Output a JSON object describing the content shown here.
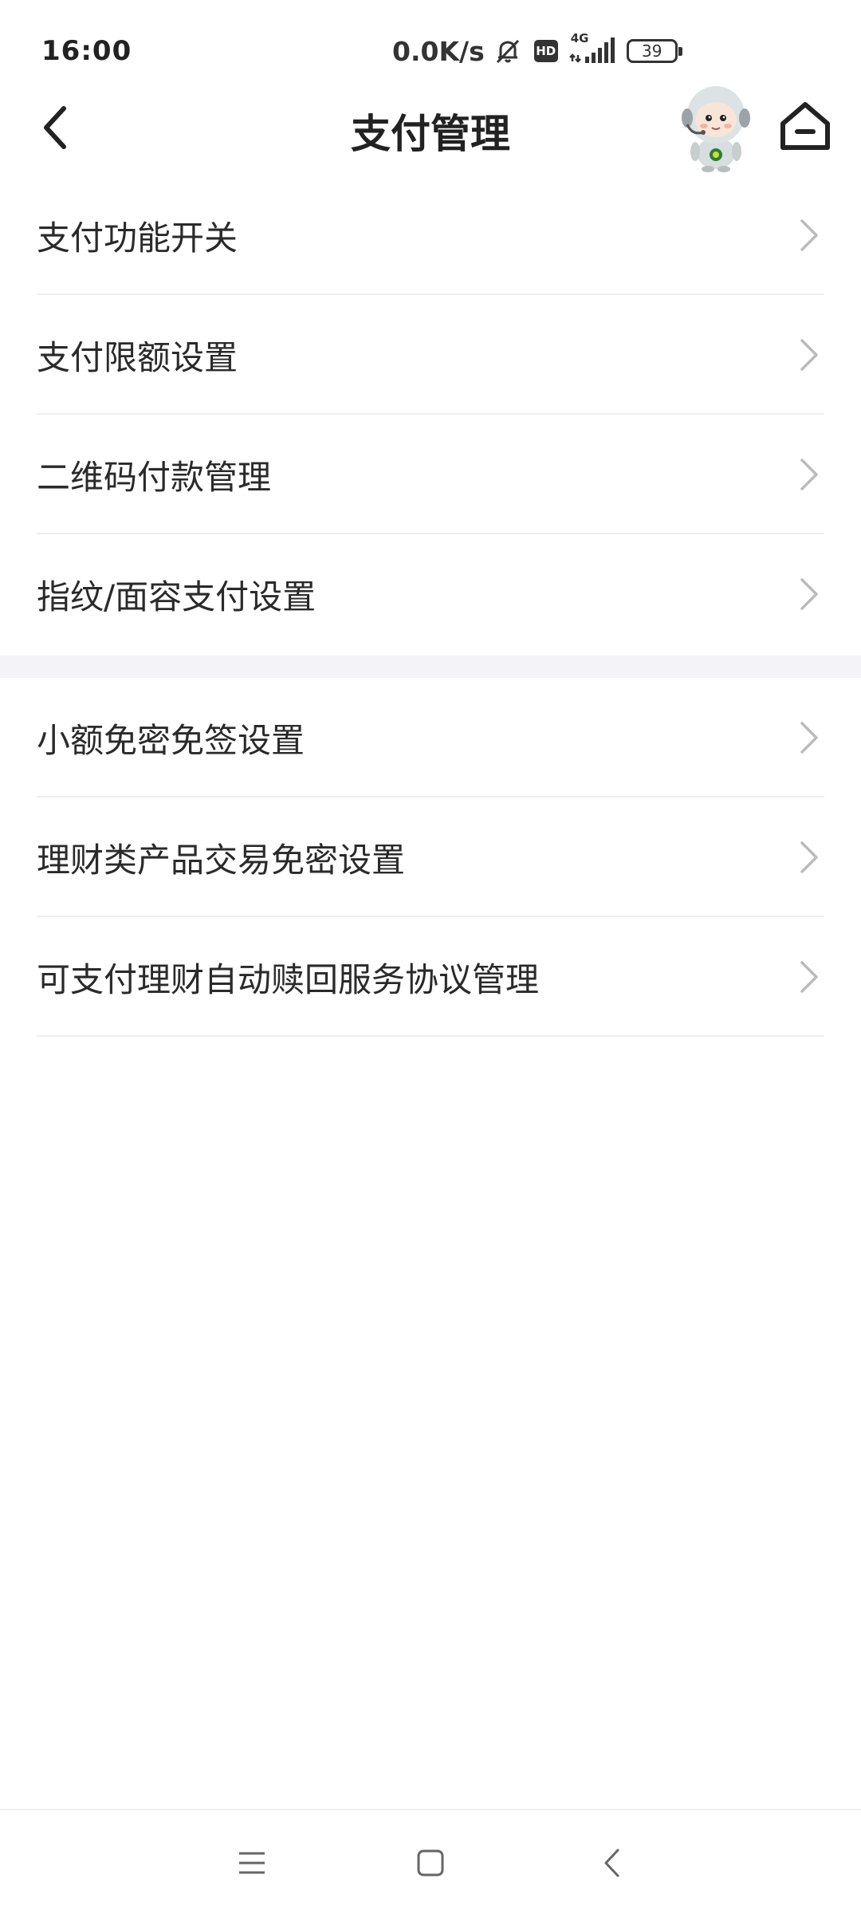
{
  "status_bar": {
    "time": "16:00",
    "net_speed": "0.0K/s",
    "hd_label": "HD",
    "network_type": "4G",
    "battery_level": "39"
  },
  "header": {
    "title": "支付管理",
    "back_icon": "chevron-left-icon",
    "home_icon": "home-icon",
    "mascot_icon": "robot-mascot-icon"
  },
  "sections": [
    {
      "items": [
        {
          "label": "支付功能开关"
        },
        {
          "label": "支付限额设置"
        },
        {
          "label": "二维码付款管理"
        },
        {
          "label": "指纹/面容支付设置"
        }
      ]
    },
    {
      "items": [
        {
          "label": "小额免密免签设置"
        },
        {
          "label": "理财类产品交易免密设置"
        },
        {
          "label": "可支付理财自动赎回服务协议管理"
        }
      ]
    }
  ],
  "colors": {
    "text_primary": "#222222",
    "chevron": "#bbbbbb",
    "divider": "#eeeeee",
    "section_gap": "#f4f4f8"
  }
}
